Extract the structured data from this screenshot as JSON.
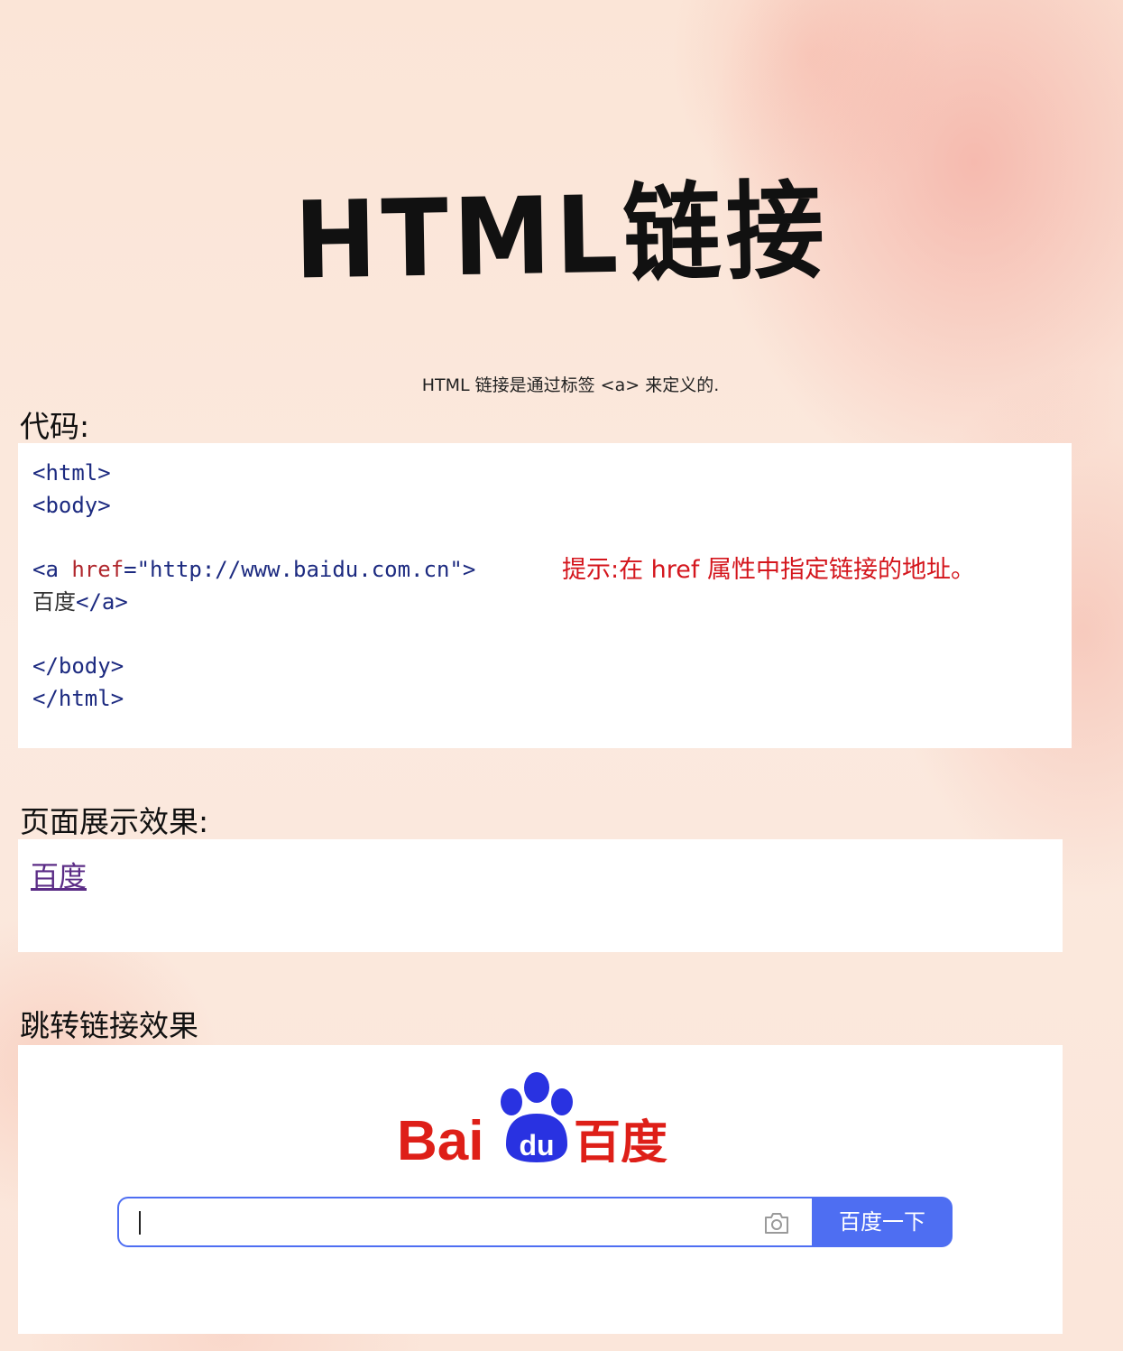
{
  "title": "HTML链接",
  "intro": "HTML 链接是通过标签 <a> 来定义的.",
  "code_section": {
    "label": "代码:",
    "lines": {
      "l1_tag": "<html>",
      "l2_tag": "<body>",
      "l3_open": "<a ",
      "l3_attr": "href",
      "l3_eq": "=",
      "l3_value": "\"http://www.baidu.com.cn\"",
      "l3_close": ">",
      "l4_text": "百度",
      "l4_tag": "</a>",
      "l5_tag": "</body>",
      "l6_tag": "</html>"
    },
    "hint": "提示:在 href 属性中指定链接的地址。"
  },
  "preview_section": {
    "label": "页面展示效果:",
    "link_text": "百度"
  },
  "jump_section": {
    "label": "跳转链接效果",
    "logo_text_left": "Bai",
    "logo_text_paw": "du",
    "logo_text_right": "百度",
    "search_button": "百度一下",
    "camera_icon": "camera-icon"
  },
  "colors": {
    "baidu_red": "#de1f18",
    "baidu_blue": "#2932e1",
    "button_blue": "#4e6ef2",
    "hint_red": "#d4161d"
  }
}
